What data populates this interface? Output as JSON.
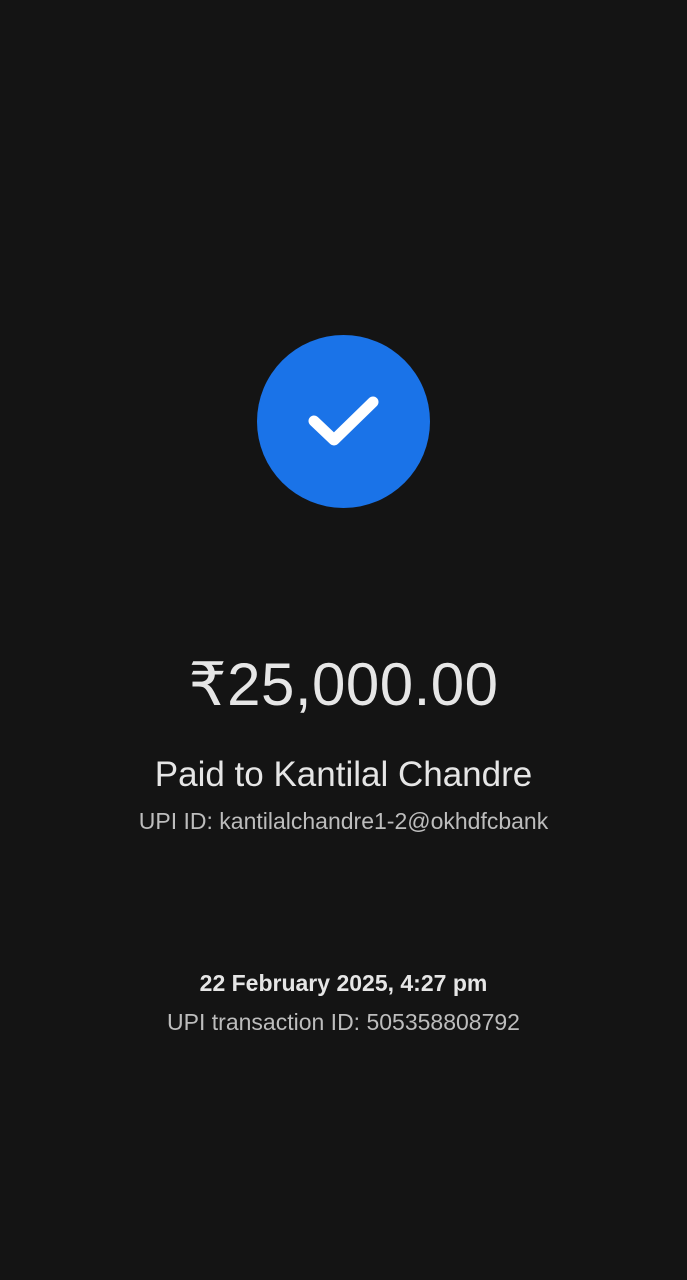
{
  "status": {
    "icon": "check-icon",
    "circle_color": "#1a73e8",
    "check_color": "#ffffff"
  },
  "payment": {
    "amount": "₹25,000.00",
    "paid_to": "Paid to Kantilal Chandre",
    "upi_id": "UPI ID: kantilalchandre1-2@okhdfcbank",
    "datetime": "22 February 2025, 4:27 pm",
    "transaction_id": "UPI transaction ID: 505358808792"
  }
}
